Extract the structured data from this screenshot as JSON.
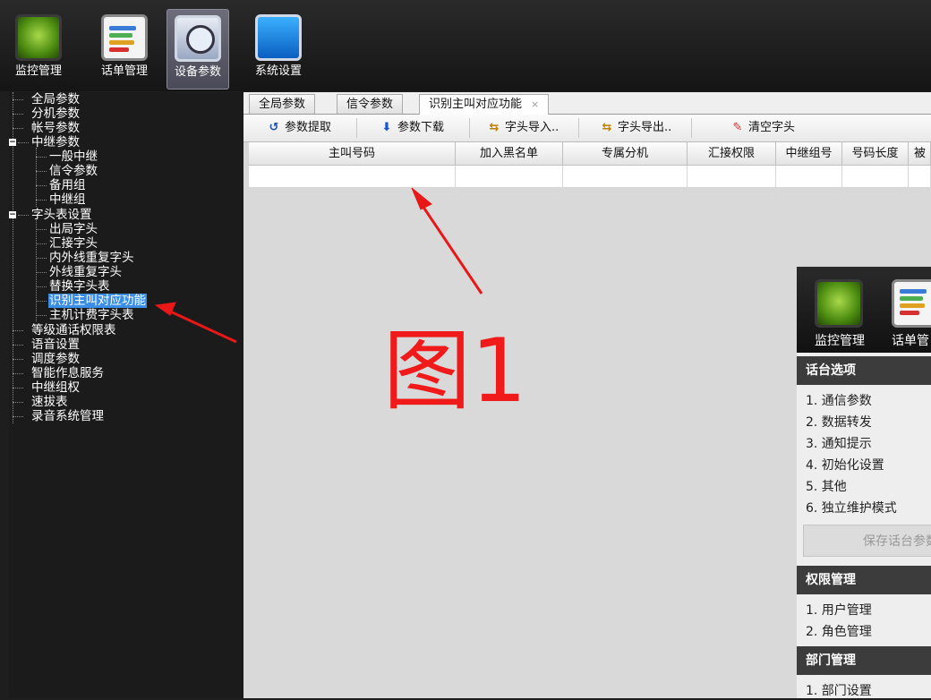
{
  "topbar": {
    "buttons": [
      {
        "label": "监控管理",
        "icon": "monitor-icon"
      },
      {
        "label": "话单管理",
        "icon": "bill-icon"
      },
      {
        "label": "设备参数",
        "icon": "device-params-icon",
        "active": true
      },
      {
        "label": "系统设置",
        "icon": "system-settings-icon"
      }
    ]
  },
  "tree": {
    "items": [
      {
        "label": "全局参数"
      },
      {
        "label": "分机参数"
      },
      {
        "label": "帐号参数"
      },
      {
        "label": "中继参数",
        "expandable": true
      },
      {
        "label": "一般中继"
      },
      {
        "label": "信令参数"
      },
      {
        "label": "备用组"
      },
      {
        "label": "中继组"
      },
      {
        "label": "字头表设置",
        "expandable": true
      },
      {
        "label": "出局字头"
      },
      {
        "label": "汇接字头"
      },
      {
        "label": "内外线重复字头"
      },
      {
        "label": "外线重复字头"
      },
      {
        "label": "替换字头表"
      },
      {
        "label": "识别主叫对应功能",
        "selected": true
      },
      {
        "label": "主机计费字头表"
      },
      {
        "label": "等级通话权限表"
      },
      {
        "label": "语音设置"
      },
      {
        "label": "调度参数"
      },
      {
        "label": "智能作息服务"
      },
      {
        "label": "中继组权"
      },
      {
        "label": "速拔表"
      },
      {
        "label": "录音系统管理"
      }
    ]
  },
  "tabs": [
    {
      "label": "全局参数"
    },
    {
      "label": "信令参数"
    },
    {
      "label": "识别主叫对应功能",
      "close": "×",
      "active": true
    }
  ],
  "toolbar": {
    "fetch": "参数提取",
    "download": "参数下载",
    "import": "字头导入..",
    "export": "字头导出..",
    "clear": "清空字头"
  },
  "grid": {
    "columns": [
      "主叫号码",
      "加入黑名单",
      "专属分机",
      "汇接权限",
      "中继组号",
      "号码长度",
      "被叫"
    ]
  },
  "annotation": {
    "figure_label": "图1",
    "color": "#f01a1a"
  },
  "overlay": {
    "buttons": [
      "监控管理",
      "话单管"
    ],
    "sections": {
      "console": {
        "title": "话台选项",
        "items": [
          "1. 通信参数",
          "2. 数据转发",
          "3. 通知提示",
          "4. 初始化设置",
          "5. 其他",
          "6. 独立维护模式"
        ],
        "save": "保存话台参数"
      },
      "permissions": {
        "title": "权限管理",
        "items": [
          "1. 用户管理",
          "2. 角色管理"
        ]
      },
      "department": {
        "title": "部门管理",
        "items": [
          "1. 部门设置"
        ]
      }
    }
  }
}
